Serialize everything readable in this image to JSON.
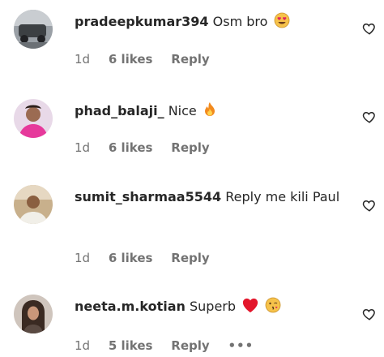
{
  "comments": [
    {
      "username": "pradeepkumar394",
      "text": "Osm bro",
      "emoji": "heart-eyes-emoji",
      "time": "1d",
      "likes": "6 likes",
      "reply": "Reply"
    },
    {
      "username": "phad_balaji_",
      "text": "Nice",
      "emoji": "fire-emoji",
      "time": "1d",
      "likes": "6 likes",
      "reply": "Reply"
    },
    {
      "username": "sumit_sharmaa5544",
      "text": "Reply me kili Paul",
      "time": "1d",
      "likes": "6 likes",
      "reply": "Reply"
    },
    {
      "username": "neeta.m.kotian",
      "text": "Superb",
      "emoji": "red-heart-emoji, winking-kiss-emoji",
      "time": "1d",
      "likes": "5 likes",
      "reply": "Reply",
      "more": "•••"
    }
  ]
}
